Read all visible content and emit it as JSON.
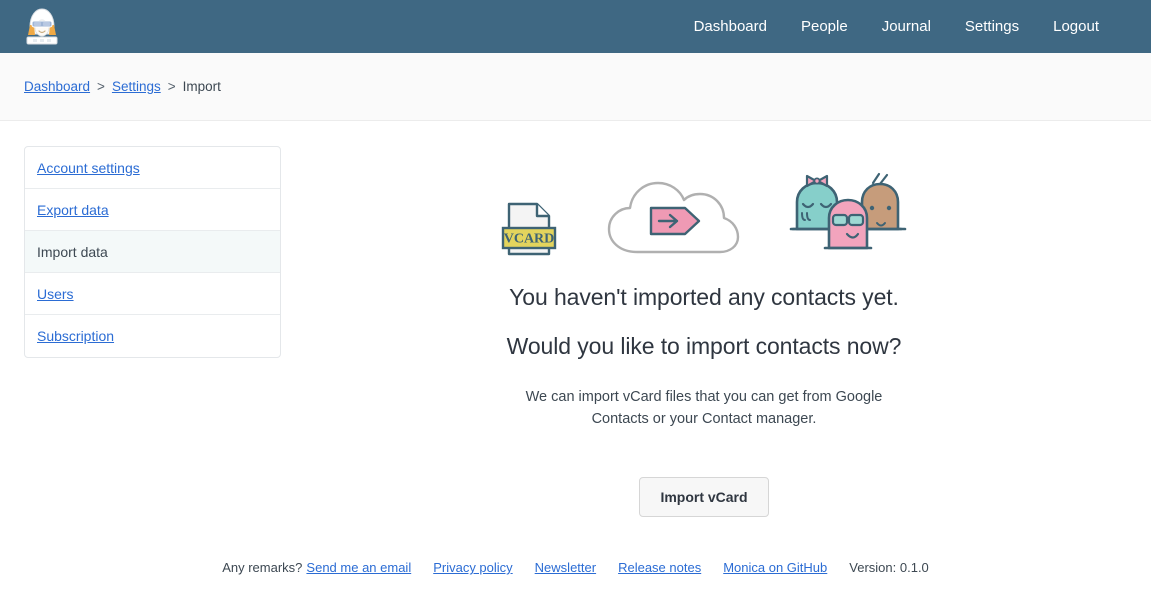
{
  "nav": {
    "brand_icon": "monica-avatar-logo",
    "links": [
      {
        "label": "Dashboard"
      },
      {
        "label": "People"
      },
      {
        "label": "Journal"
      },
      {
        "label": "Settings"
      },
      {
        "label": "Logout"
      }
    ]
  },
  "breadcrumb": {
    "items": [
      {
        "label": "Dashboard",
        "link": true
      },
      {
        "label": "Settings",
        "link": true
      },
      {
        "label": "Import",
        "link": false
      }
    ],
    "separator": ">"
  },
  "sidebar": {
    "items": [
      {
        "label": "Account settings",
        "active": false
      },
      {
        "label": "Export data",
        "active": false
      },
      {
        "label": "Import data",
        "active": true
      },
      {
        "label": "Users",
        "active": false
      },
      {
        "label": "Subscription",
        "active": false
      }
    ]
  },
  "main": {
    "illustration": {
      "vcard_label": "VCARD",
      "icons": [
        "vcard-file-icon",
        "cloud-upload-icon",
        "contacts-characters-icon"
      ]
    },
    "headline_1": "You haven't imported any contacts yet.",
    "headline_2": "Would you like to import contacts now?",
    "description": "We can import vCard files that you can get from Google Contacts or your Contact manager.",
    "import_button": "Import vCard"
  },
  "footer": {
    "remark_label": "Any remarks?",
    "email_link": "Send me an email",
    "links": [
      {
        "label": "Privacy policy"
      },
      {
        "label": "Newsletter"
      },
      {
        "label": "Release notes"
      },
      {
        "label": "Monica on GitHub"
      }
    ],
    "version": "Version: 0.1.0"
  },
  "colors": {
    "navbar": "#3f6883",
    "link": "#2b6cd4",
    "active_row": "#f4f9f9",
    "breadcrumb_band": "#fafafa",
    "ink": "#2f3640",
    "illustration_outline": "#3e6374",
    "vcard_yellow": "#e3d45d",
    "pink": "#ef9ab4",
    "teal": "#86cfca",
    "tan": "#c69c7b"
  }
}
